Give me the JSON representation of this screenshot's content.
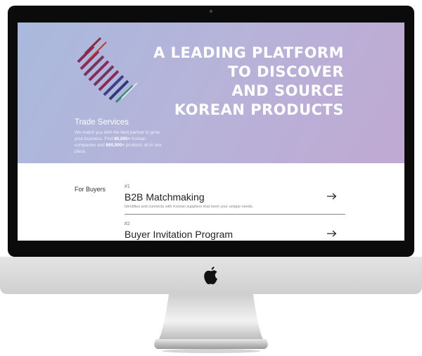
{
  "hero": {
    "headline_lines": [
      "A LEADING PLATFORM",
      "TO DISCOVER",
      "AND SOURCE",
      "KOREAN PRODUCTS"
    ],
    "trade_services": {
      "title": "Trade Services",
      "desc_part1": "We match you with the best partner to grow your business. Find ",
      "desc_bold1": "80,000+",
      "desc_part2": " Korean companies and ",
      "desc_bold2": "800,000+",
      "desc_part3": " products all in one place."
    }
  },
  "section": {
    "label": "For Buyers",
    "items": [
      {
        "num": "#1",
        "title": "B2B Matchmaking",
        "desc": "Identifies and connects with Korean suppliers that meet your unique needs."
      },
      {
        "num": "#2",
        "title": "Buyer Invitation Program",
        "desc": ""
      }
    ]
  },
  "colors": {
    "hero_gradient_start": "#a9b9dd",
    "hero_gradient_end": "#c0a9d2",
    "bezel": "#0b0b0b",
    "chin": "#d9d9d9"
  },
  "icons": {
    "logo": "striped-diamond-logo",
    "arrow": "arrow-right-icon",
    "apple": "apple-logo-icon"
  }
}
